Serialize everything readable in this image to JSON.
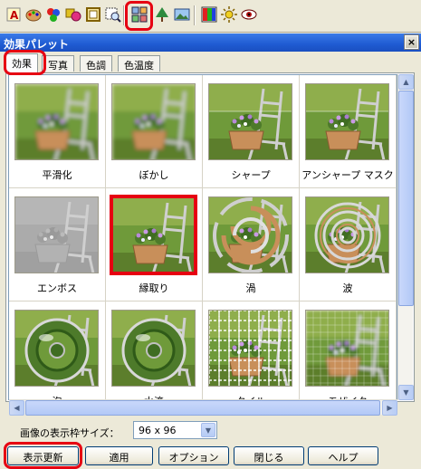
{
  "toolbar": {
    "icons": [
      "text-tool-icon",
      "paint-palette-icon",
      "color-balls-icon",
      "shapes-icon",
      "frame-icon",
      "zoom-select-icon",
      "effect-palette-icon",
      "tree-icon",
      "image-icon",
      "color-grid-icon",
      "brightness-icon",
      "eye-icon"
    ]
  },
  "palette": {
    "title": "効果パレット",
    "close_glyph": "×",
    "tabs": [
      "効果",
      "写真",
      "色調",
      "色温度"
    ],
    "active_tab": 0,
    "effects": [
      {
        "label": "平滑化",
        "style": "blur"
      },
      {
        "label": "ぼかし",
        "style": "blur"
      },
      {
        "label": "シャープ",
        "style": "sharp"
      },
      {
        "label": "アンシャープ マスク",
        "style": "sharp"
      },
      {
        "label": "エンボス",
        "style": "emboss"
      },
      {
        "label": "縁取り",
        "style": "frame",
        "selected": true
      },
      {
        "label": "渦",
        "style": "swirl"
      },
      {
        "label": "波",
        "style": "ripple"
      },
      {
        "label": "泡",
        "style": "bubble"
      },
      {
        "label": "水滴",
        "style": "drop"
      },
      {
        "label": "タイル",
        "style": "tile"
      },
      {
        "label": "モザイク",
        "style": "mosaic"
      }
    ]
  },
  "size_label": "画像の表示枠サイズ：",
  "size_value": "96 x 96",
  "buttons": {
    "refresh": "表示更新",
    "apply": "適用",
    "options": "オプション",
    "close": "閉じる",
    "help": "ヘルプ"
  },
  "colors": {
    "highlight": "#e60012",
    "titlebar": "#1f5bd2"
  }
}
